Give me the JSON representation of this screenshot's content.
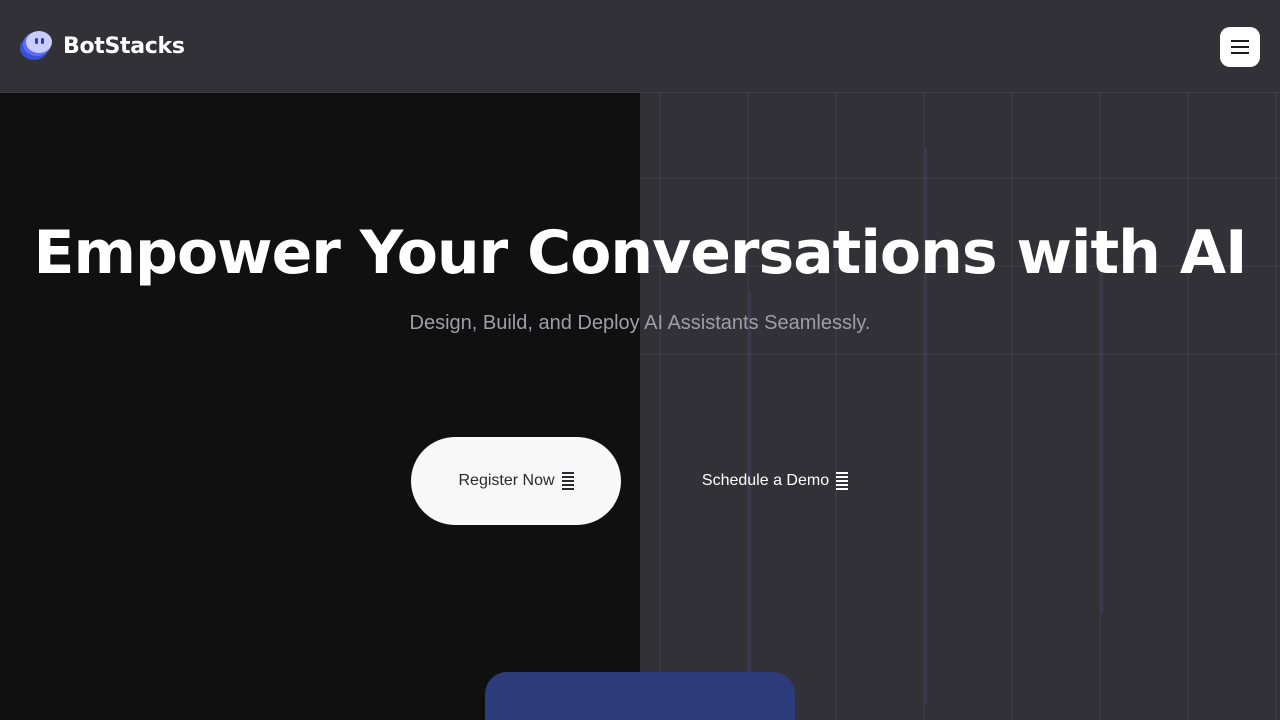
{
  "header": {
    "brand_name": "BotStacks",
    "logo_icon": "chat-bubble-logo-icon",
    "menu_icon": "hamburger-menu-icon"
  },
  "hero": {
    "title": "Empower Your Conversations with AI",
    "subtitle": "Design, Build, and Deploy AI Assistants Seamlessly.",
    "primary_button": "Register Now",
    "secondary_button": "Schedule a Demo",
    "button_icon": "striped-bars-icon"
  },
  "colors": {
    "background": "#323137",
    "left_panel": "#101011",
    "primary_button_bg": "#f8f8f8",
    "accent_card": "#2d3b7a",
    "logo_accent": "#5b6ef5"
  }
}
